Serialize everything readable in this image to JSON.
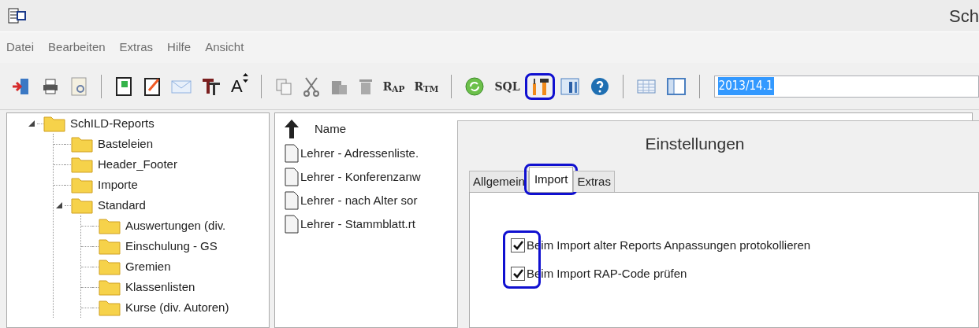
{
  "window": {
    "title": "Sch"
  },
  "menu": [
    "Datei",
    "Bearbeiten",
    "Extras",
    "Hilfe",
    "Ansicht"
  ],
  "toolbar": {
    "groups": [
      [
        {
          "kind": "icon",
          "highlighted": false
        },
        {
          "kind": "icon",
          "highlighted": false
        },
        {
          "kind": "icon",
          "highlighted": false
        }
      ],
      [
        {
          "kind": "icon",
          "highlighted": false
        },
        {
          "kind": "icon",
          "highlighted": false
        },
        {
          "kind": "icon",
          "highlighted": false
        },
        {
          "kind": "icon",
          "highlighted": false
        },
        {
          "kind": "sizer",
          "label": "A",
          "highlighted": false
        }
      ],
      [
        {
          "kind": "icon",
          "highlighted": false
        },
        {
          "kind": "icon",
          "highlighted": false
        },
        {
          "kind": "icon",
          "highlighted": false
        },
        {
          "kind": "icon",
          "highlighted": false
        },
        {
          "kind": "text",
          "label": "R$_{AP}$",
          "highlighted": false
        },
        {
          "kind": "text",
          "label": "R$_{TM}$",
          "highlighted": false
        }
      ],
      [
        {
          "kind": "icon",
          "highlighted": false
        },
        {
          "kind": "text",
          "label": "SQL",
          "highlighted": false
        },
        {
          "kind": "icon",
          "highlighted": true
        },
        {
          "kind": "icon",
          "highlighted": false
        },
        {
          "kind": "icon",
          "highlighted": false
        }
      ],
      [
        {
          "kind": "icon",
          "highlighted": false
        },
        {
          "kind": "icon",
          "highlighted": false
        }
      ]
    ],
    "school_year": "2013/14.1"
  },
  "tree": [
    {
      "label": "SchILD-Reports",
      "expanded": true,
      "children": [
        {
          "label": "Basteleien"
        },
        {
          "label": "Header_Footer"
        },
        {
          "label": "Importe"
        },
        {
          "label": "Standard",
          "expanded": true,
          "children": [
            {
              "label": "Auswertungen (div."
            },
            {
              "label": "Einschulung - GS"
            },
            {
              "label": "Gremien"
            },
            {
              "label": "Klassenlisten"
            },
            {
              "label": "Kurse (div. Autoren)"
            }
          ]
        }
      ]
    }
  ],
  "files": {
    "column": "Name",
    "rows": [
      "Lehrer - Adressenliste.",
      "Lehrer - Konferenzanw",
      "Lehrer - nach Alter sor",
      "Lehrer - Stammblatt.rt"
    ]
  },
  "dialog": {
    "title": "Einstellungen",
    "tabs": [
      {
        "label": "Allgemein",
        "selected": false,
        "highlighted": false
      },
      {
        "label": "Import",
        "selected": true,
        "highlighted": true
      },
      {
        "label": "Extras",
        "selected": false,
        "highlighted": false
      }
    ],
    "options_highlighted": true,
    "options": [
      {
        "label": "Beim Import alter Reports Anpassungen protokollieren",
        "checked": true
      },
      {
        "label": "Beim Import RAP-Code prüfen",
        "checked": true
      }
    ]
  }
}
